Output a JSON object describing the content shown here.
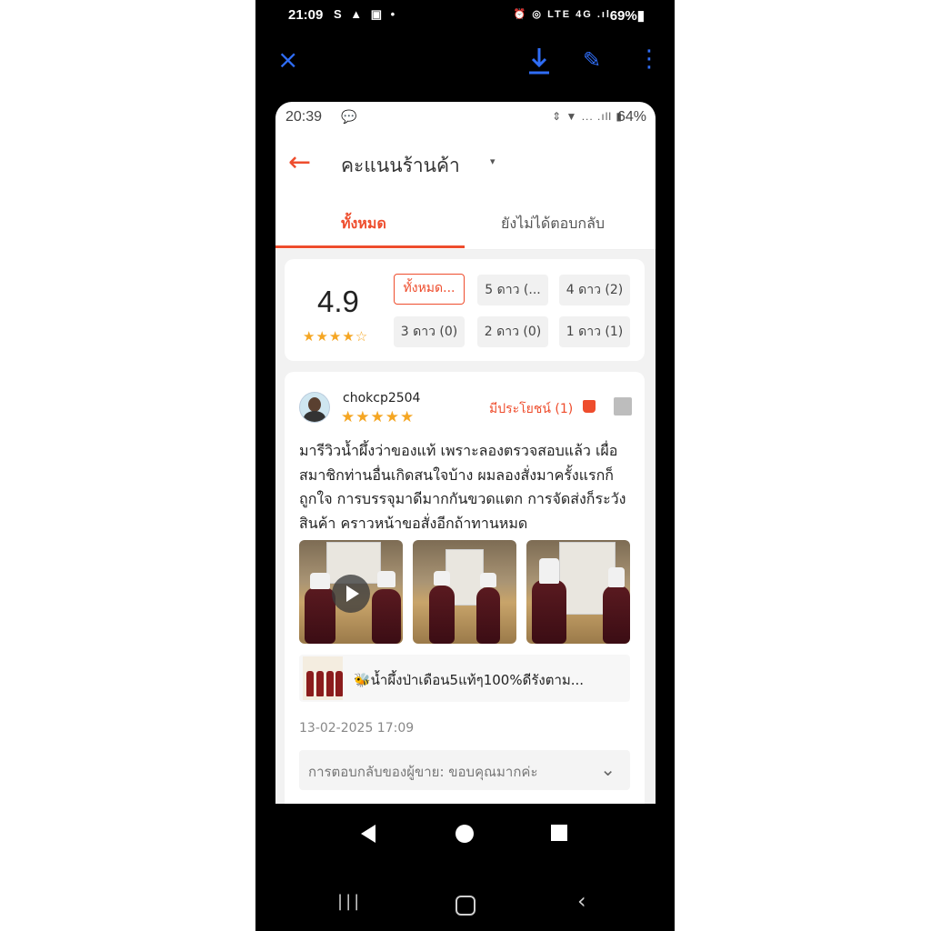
{
  "outer_status": {
    "time": "21:09",
    "left_icons": "S ▲ ▣ •",
    "right_icons": "⏰ ◎ LTE 4G .ıl",
    "battery": "69%▮"
  },
  "viewer": {
    "close_icon": "×"
  },
  "inner_status": {
    "time": "20:39",
    "right_icons": "⇕ ▼ ... .ıll ▮",
    "battery": "64%"
  },
  "header": {
    "back_icon": "←",
    "title": "คะแนนร้านค้า",
    "dropdown_icon": "▾"
  },
  "tabs": [
    {
      "label": "ทั้งหมด",
      "active": true
    },
    {
      "label": "ยังไม่ได้ตอบกลับ",
      "active": false
    }
  ],
  "rating": {
    "score": "4.9",
    "stars": "★★★★☆",
    "filters": [
      "ทั้งหมด...",
      "5 ดาว (...",
      "4 ดาว (2)",
      "3 ดาว (0)",
      "2 ดาว (0)",
      "1 ดาว (1)"
    ]
  },
  "review": {
    "username": "chokcp2504",
    "stars": "★★★★★",
    "helpful": "มีประโยชน์ (1)",
    "text": "มารีวิวน้ำผึ้งว่าของแท้ เพราะลองตรวจสอบแล้ว เผื่อสมาชิกท่านอื่นเกิดสนใจบ้าง ผมลองสั่งมาครั้งแรกก็ถูกใจ การบรรจุมาดีมากกันขวดแตก การจัดส่งก็ระวังสินค้า คราวหน้าขอสั่งอีกถ้าทานหมด",
    "product_name": "🐝น้ำผึ้งป่าเดือน5แท้ๆ100%ดีรังตาม...",
    "date": "13-02-2025 17:09",
    "seller_reply": "การตอบกลับของผู้ขาย: ขอบคุณมากค่ะ",
    "reply_chevron": "⌄"
  },
  "nav": {
    "recents_icon": "|||",
    "back_icon": "‹"
  },
  "colors": {
    "accent": "#ee4d2d",
    "star": "#f5a623",
    "viewer_blue": "#2f6df6"
  }
}
